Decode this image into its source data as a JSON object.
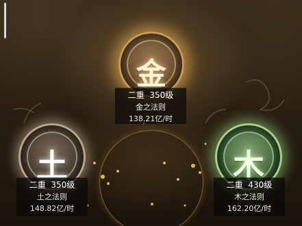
{
  "elements": [
    {
      "id": "metal",
      "glyph": "金",
      "tier": "二重",
      "level": "350级",
      "law": "金之法则",
      "rate": "138.21亿/时",
      "color": "#c79b52"
    },
    {
      "id": "earth",
      "glyph": "土",
      "tier": "二重",
      "level": "350级",
      "law": "土之法则",
      "rate": "148.82亿/时",
      "color": "#b9a58a"
    },
    {
      "id": "wood",
      "glyph": "木",
      "tier": "二重",
      "level": "430级",
      "law": "木之法则",
      "rate": "162.20亿/时",
      "color": "#a9d08a"
    }
  ]
}
